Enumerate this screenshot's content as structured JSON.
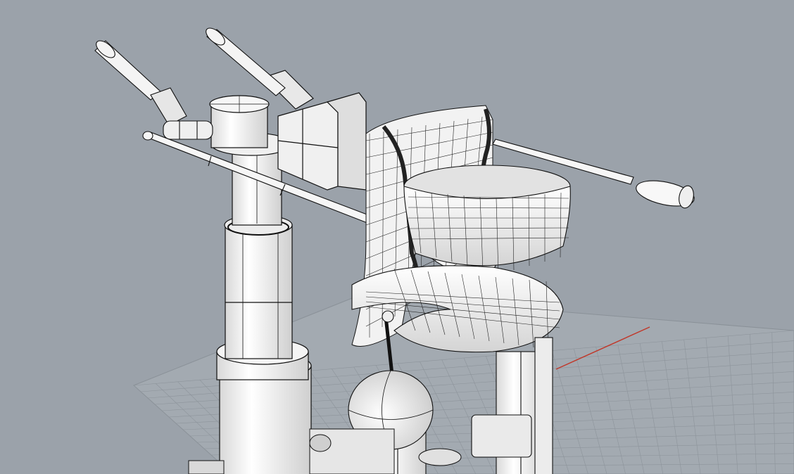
{
  "viewport": {
    "background": "#9ba2aa",
    "grid_color": "#8a9198",
    "grid_plane_color": "#a3aab1",
    "axis_x_color": "#c0392b",
    "model_fill": "#f4f4f4",
    "model_shade": "#d9d9d9",
    "wire_color": "#111111",
    "display_mode": "shaded-with-wireframe"
  }
}
